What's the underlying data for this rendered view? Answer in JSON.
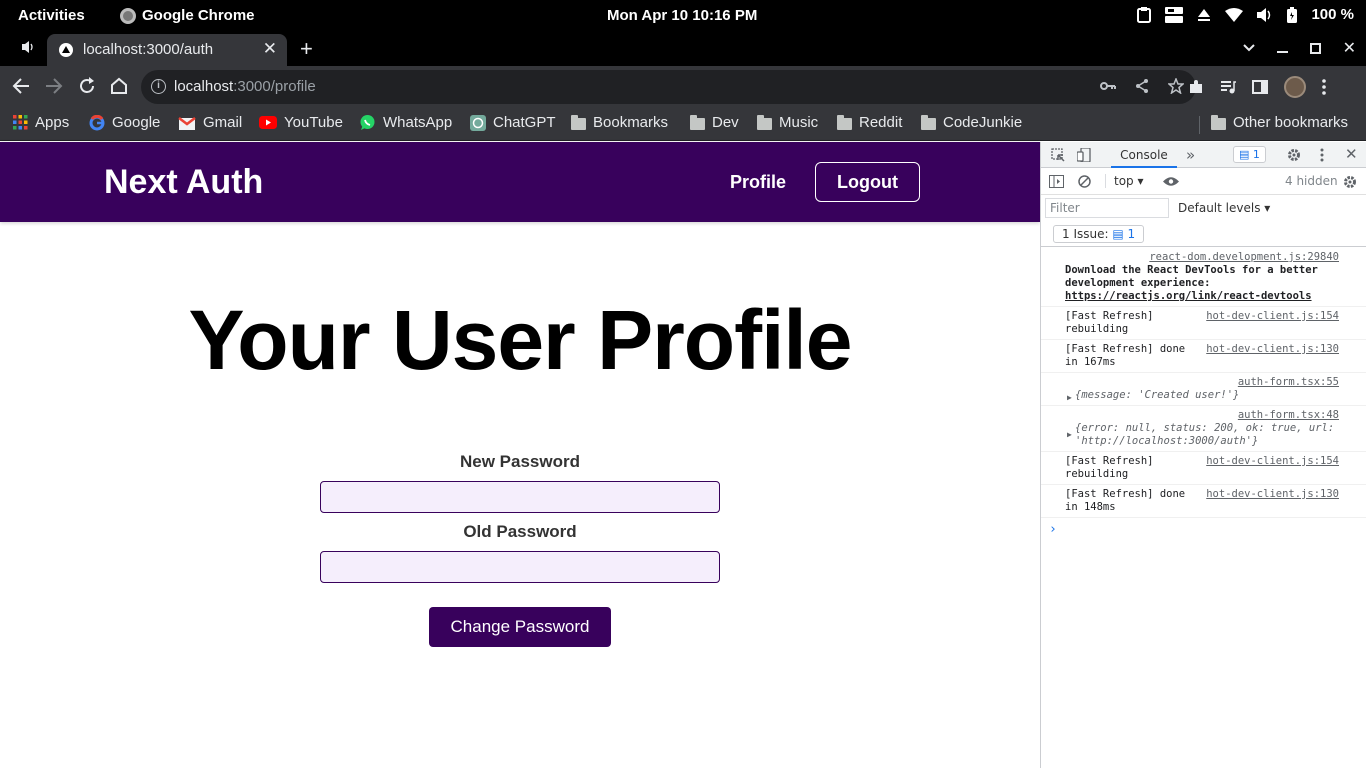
{
  "system_bar": {
    "activities": "Activities",
    "app_name": "Google Chrome",
    "clock": "Mon Apr 10  10:16 PM",
    "battery": "100 %"
  },
  "browser": {
    "tab_title": "localhost:3000/auth",
    "url_host": "localhost",
    "url_rest": ":3000/profile"
  },
  "bookmarks": [
    {
      "label": "Apps",
      "icon": "apps-grid-icon"
    },
    {
      "label": "Google",
      "icon": "google-icon"
    },
    {
      "label": "Gmail",
      "icon": "gmail-icon"
    },
    {
      "label": "YouTube",
      "icon": "youtube-icon"
    },
    {
      "label": "WhatsApp",
      "icon": "whatsapp-icon"
    },
    {
      "label": "ChatGPT",
      "icon": "chatgpt-icon"
    },
    {
      "label": "Bookmarks",
      "icon": "folder-icon"
    },
    {
      "label": "Dev",
      "icon": "folder-icon"
    },
    {
      "label": "Music",
      "icon": "folder-icon"
    },
    {
      "label": "Reddit",
      "icon": "folder-icon"
    },
    {
      "label": "CodeJunkie",
      "icon": "folder-icon"
    }
  ],
  "other_bookmarks": "Other bookmarks",
  "app": {
    "logo": "Next Auth",
    "nav_profile": "Profile",
    "nav_logout": "Logout",
    "heading": "Your User Profile",
    "new_password_label": "New Password",
    "old_password_label": "Old Password",
    "submit_label": "Change Password",
    "brand_color": "#38015c"
  },
  "devtools": {
    "active_tab": "Console",
    "issues_badge": "1",
    "context": "top",
    "hidden_count": "4 hidden",
    "filter_placeholder": "Filter",
    "levels": "Default levels",
    "issue_text": "1 Issue:",
    "issue_count": "1",
    "logs": [
      {
        "src": "react-dom.development.js:29840",
        "text": "Download the React DevTools for a better development experience: ",
        "link": "https://reactjs.org/link/react-devtools"
      },
      {
        "src": "hot-dev-client.js:154",
        "text": "[Fast Refresh] rebuilding"
      },
      {
        "src": "hot-dev-client.js:130",
        "text": "[Fast Refresh] done in 167ms"
      },
      {
        "src": "auth-form.tsx:55",
        "text": "{message: 'Created user!'}"
      },
      {
        "src": "auth-form.tsx:48",
        "text": "{error: null, status: 200, ok: true, url: 'http://localhost:3000/auth'}"
      },
      {
        "src": "hot-dev-client.js:154",
        "text": "[Fast Refresh] rebuilding"
      },
      {
        "src": "hot-dev-client.js:130",
        "text": "[Fast Refresh] done in 148ms"
      }
    ]
  }
}
